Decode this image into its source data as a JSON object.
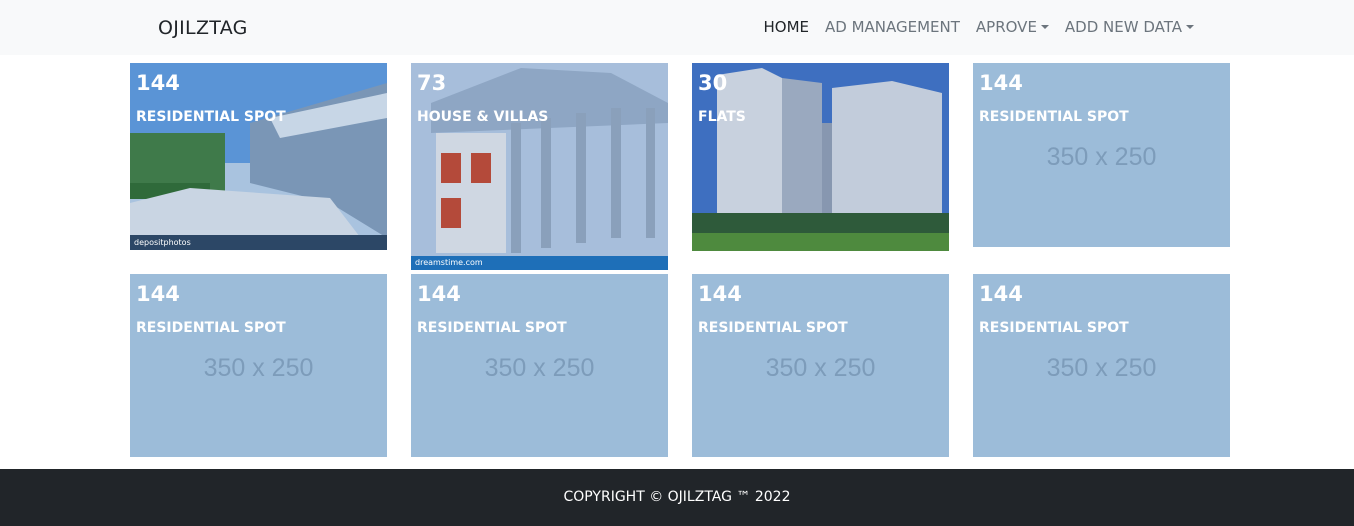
{
  "navbar": {
    "brand": "OJILZTAG",
    "links": [
      {
        "label": "HOME",
        "active": true
      },
      {
        "label": "AD MANAGEMENT"
      },
      {
        "label": "APROVE"
      },
      {
        "label": "ADD NEW DATA"
      }
    ]
  },
  "cards": [
    {
      "count": "144",
      "label": "RESIDENTIAL SPOT",
      "watermark": "depositphotos"
    },
    {
      "count": "73",
      "label": "HOUSE & VILLAS",
      "watermark": "dreamstime.com"
    },
    {
      "count": "30",
      "label": "FLATS"
    },
    {
      "count": "144",
      "label": "RESIDENTIAL SPOT",
      "placeholder": "350 x 250"
    },
    {
      "count": "144",
      "label": "RESIDENTIAL SPOT",
      "placeholder": "350 x 250"
    },
    {
      "count": "144",
      "label": "RESIDENTIAL SPOT",
      "placeholder": "350 x 250"
    },
    {
      "count": "144",
      "label": "RESIDENTIAL SPOT",
      "placeholder": "350 x 250"
    },
    {
      "count": "144",
      "label": "RESIDENTIAL SPOT",
      "placeholder": "350 x 250"
    }
  ],
  "footer": {
    "text": "COPYRIGHT © OJILZTAG ™ 2022"
  }
}
